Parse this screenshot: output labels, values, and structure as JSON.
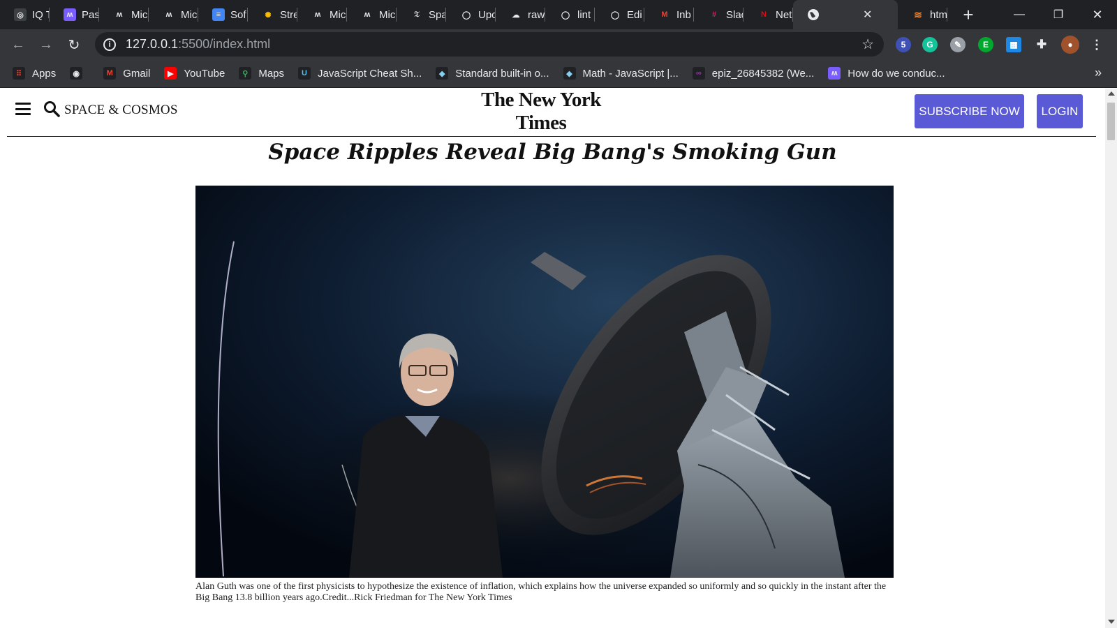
{
  "browser": {
    "tabs": [
      {
        "label": "IQ T",
        "icon": "circle-icon",
        "color": "#3c4043"
      },
      {
        "label": "Pas",
        "icon": "miro-icon",
        "color": "#7b5cff"
      },
      {
        "label": "Mic",
        "icon": "miro-icon",
        "color": "#202124"
      },
      {
        "label": "Mic",
        "icon": "miro-icon",
        "color": "#202124"
      },
      {
        "label": "Sof",
        "icon": "doc-icon",
        "color": "#4285f4"
      },
      {
        "label": "Stre",
        "icon": "dots-icon",
        "color": "#202124"
      },
      {
        "label": "Mic",
        "icon": "miro-icon",
        "color": "#202124"
      },
      {
        "label": "Mic",
        "icon": "miro-icon",
        "color": "#202124"
      },
      {
        "label": "Spa",
        "icon": "nyt-icon",
        "color": "#202124"
      },
      {
        "label": "Upc",
        "icon": "github-icon",
        "color": "#202124"
      },
      {
        "label": "raw",
        "icon": "cloud-icon",
        "color": "#202124"
      },
      {
        "label": "lint",
        "icon": "github-icon",
        "color": "#202124"
      },
      {
        "label": "Edi",
        "icon": "github-icon",
        "color": "#202124"
      },
      {
        "label": "Inb",
        "icon": "gmail-icon",
        "color": "#202124"
      },
      {
        "label": "Slac",
        "icon": "slack-icon",
        "color": "#202124"
      },
      {
        "label": "Net",
        "icon": "netflix-icon",
        "color": "#202124"
      }
    ],
    "active_tab": {
      "label": "",
      "icon": "globe-icon"
    },
    "last_tab": {
      "label": "htm",
      "icon": "stackoverflow-icon"
    },
    "url_host": "127.0.0.1",
    "url_path": ":5500/index.html",
    "extension_badge": "5",
    "bookmarks": [
      {
        "label": "Apps",
        "icon": "apps-grid-icon",
        "color": "#202124"
      },
      {
        "label": "",
        "icon": "globe-icon",
        "color": "#202124"
      },
      {
        "label": "Gmail",
        "icon": "gmail-icon",
        "color": "#202124"
      },
      {
        "label": "YouTube",
        "icon": "youtube-icon",
        "color": "#ff0000"
      },
      {
        "label": "Maps",
        "icon": "maps-icon",
        "color": "#202124"
      },
      {
        "label": "JavaScript Cheat Sh...",
        "icon": "cheatsheet-icon",
        "color": "#202124"
      },
      {
        "label": "Standard built-in o...",
        "icon": "mdn-icon",
        "color": "#202124"
      },
      {
        "label": "Math - JavaScript |...",
        "icon": "mdn-icon",
        "color": "#202124"
      },
      {
        "label": "epiz_26845382 (We...",
        "icon": "infinity-icon",
        "color": "#202124"
      },
      {
        "label": "How do we conduc...",
        "icon": "miro-icon",
        "color": "#7b5cff"
      }
    ]
  },
  "page": {
    "section": "SPACE & COSMOS",
    "logo": "The New York Times",
    "subscribe_label": "SUBSCRIBE NOW",
    "login_label": "LOGIN",
    "headline": "Space Ripples Reveal Big Bang's Smoking Gun",
    "caption": "Alan Guth was one of the first physicists to hypothesize the existence of inflation, which explains how the universe expanded so uniformly and so quickly in the instant after the Big Bang 13.8 billion years ago.Credit...Rick Friedman for The New York Times",
    "accent_color": "#5a5ad6"
  }
}
